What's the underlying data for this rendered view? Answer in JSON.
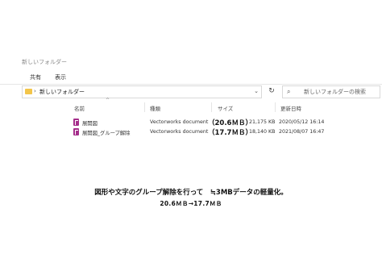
{
  "window": {
    "title": "新しいフォルダー"
  },
  "ribbon": {
    "tabs": [
      "共有",
      "表示"
    ]
  },
  "address": {
    "path": "新しいフォルダー",
    "separator": "›"
  },
  "search": {
    "placeholder": "新しいフォルダーの検索"
  },
  "columns": {
    "name": "名前",
    "type": "種類",
    "size": "サイズ",
    "date": "更新日時"
  },
  "files": [
    {
      "name": "展開図",
      "type": "Vectorworks document",
      "note": "（20.6ＭＢ）",
      "size": "21,175 KB",
      "date": "2020/05/12 16:14"
    },
    {
      "name": "展開図_グループ解除",
      "type": "Vectorworks document",
      "note": "（17.7ＭＢ）",
      "size": "18,140 KB",
      "date": "2021/08/07 16:47"
    }
  ],
  "caption": "図形や文字のグループ解除を行って　≒3MBデータの軽量化。",
  "subcaption": "20.6ＭＢ→17.7ＭＢ",
  "colors": {
    "file_icon": "#a52e8b",
    "folder_icon": "#f3c54a"
  }
}
